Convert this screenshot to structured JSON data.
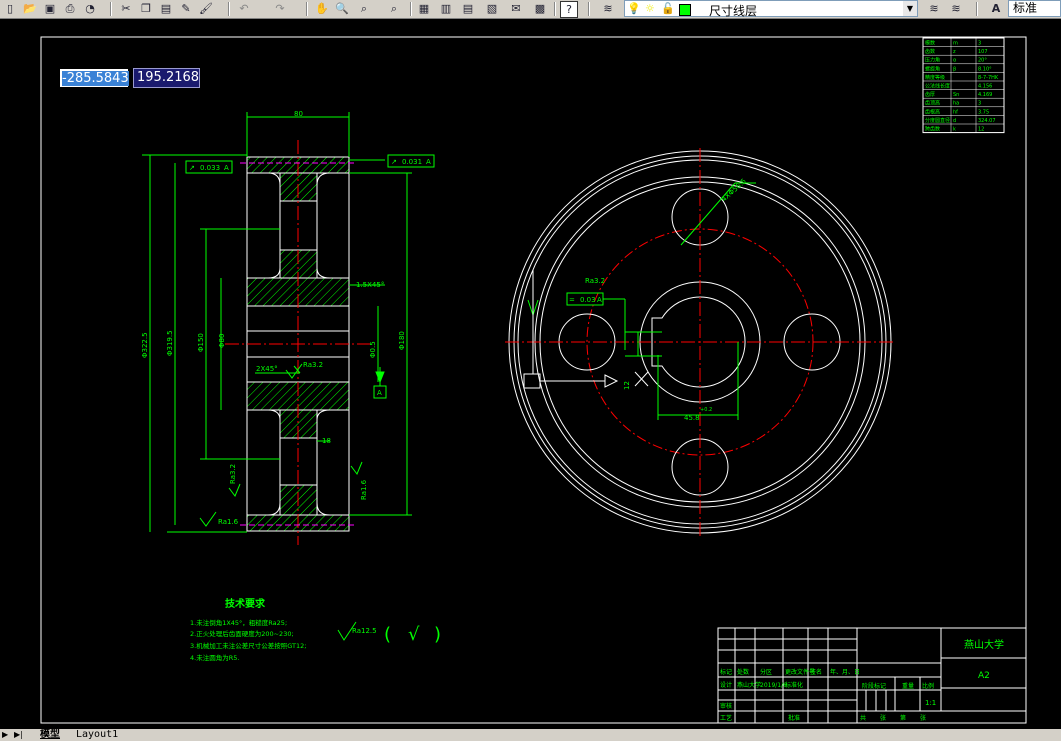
{
  "toolbar": {
    "layer_name": "尺寸线层",
    "text_style": "标准",
    "icons": [
      "new-icon",
      "open-icon",
      "save-icon",
      "print-icon",
      "preview-icon",
      "publish-icon",
      "cut-icon",
      "copy-icon",
      "paste-icon",
      "matchprop-icon",
      "brush-icon",
      "undo-icon",
      "redo-icon",
      "pan-icon",
      "zoom-realtime-icon",
      "zoom-window-icon",
      "zoom-previous-icon",
      "properties-icon",
      "designcenter-icon",
      "toolpalette-icon",
      "sheetset-icon",
      "markup-icon",
      "calculator-icon",
      "help-icon",
      "layer-manager-icon",
      "bulb-icon",
      "sun-icon",
      "lock-icon",
      "color-icon",
      "make-current-icon",
      "layer-previous-icon",
      "text-style-icon"
    ]
  },
  "coordinate_input": {
    "x": "-285.5843",
    "y": "195.2168"
  },
  "drawing": {
    "top_dim": "80",
    "left_tol_1": {
      "symbol": "↗",
      "value": "0.033",
      "datum": "A"
    },
    "right_tol_1": {
      "symbol": "↗",
      "value": "0.031",
      "datum": "A"
    },
    "chamfer_1": "1.5X45°",
    "chamfer_2": "2X45°",
    "rough_1": "Ra3.2",
    "rough_2": "Ra1.6",
    "rough_3": "Ra3.2",
    "rough_4": "Ra1.6",
    "dim_small": "18",
    "left_vert_dims": [
      "Φ322.5",
      "Φ319.5",
      "Φ150",
      "Φ80"
    ],
    "right_vert_dims": [
      "Φ0.5",
      "Φ180"
    ],
    "datum_a": "A",
    "right_view_hole_dim": "4XΦ56.5",
    "right_view_keyway_dim": "45.8",
    "right_view_keyway_tol": "+0.2",
    "right_view_key_w": "12",
    "right_view_tol": {
      "symbol": "=",
      "value": "0.03",
      "datum": "A"
    },
    "right_view_rough": "Ra3.2"
  },
  "tech_req": {
    "title": "技术要求",
    "items": [
      "1.未注倒角1X45°，粗糙度Ra25;",
      "2.正火处理后齿面硬度为200~230;",
      "3.机械加工未注公差尺寸公差按照GT12;",
      "4.未注圆角为R5."
    ],
    "rough_symbol": "Ra12.5",
    "paren_open": "(",
    "check": "√",
    "paren_close": ")"
  },
  "param_table": {
    "rows": [
      [
        "模数",
        "m",
        "3"
      ],
      [
        "齿数",
        "z",
        "107"
      ],
      [
        "压力角",
        "α",
        "20°"
      ],
      [
        "螺旋角",
        "β",
        "8.10°"
      ],
      [
        "精度等级",
        "",
        "8-7-7HK"
      ],
      [
        "公法线长度",
        "",
        "4.156"
      ],
      [
        "齿厚",
        "Sn",
        "4.169"
      ],
      [
        "齿顶高",
        "ha",
        "3"
      ],
      [
        "齿根高",
        "hf",
        "3.75"
      ],
      [
        "分度圆直径",
        "d",
        "324.07"
      ],
      [
        "跨齿数",
        "k",
        "12"
      ]
    ]
  },
  "title_block": {
    "school": "燕山大学",
    "drawing_no": "A2",
    "scale": "1:1",
    "designer_row": [
      "标记",
      "处数",
      "分区",
      "更改文件号",
      "签名",
      "年、月、日"
    ],
    "design_row": [
      "设计",
      "燕山大学",
      "2019/1/6",
      "标准化"
    ],
    "check_row": "审核",
    "process_row": "工艺",
    "approve": "批准",
    "stage_label": "阶段标记",
    "weight_label": "重量",
    "ratio_label": "比例",
    "sheet_row": [
      "共",
      "张",
      "第",
      "张"
    ]
  },
  "tabs": {
    "model": "模型",
    "layout1": "Layout1"
  },
  "colors": {
    "line": "#ffffff",
    "dimension": "#00ff00",
    "center": "#ff0000",
    "hatch": "#00ff00",
    "hidden": "#ff00ff"
  }
}
